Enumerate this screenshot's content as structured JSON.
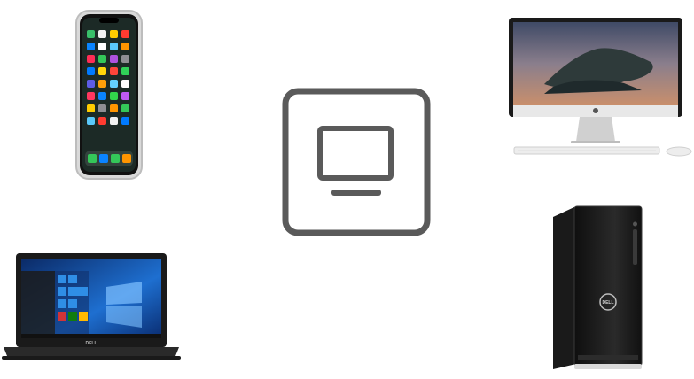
{
  "icons": {
    "phone": "smartphone-icon",
    "imac": "desktop-all-in-one-icon",
    "center": "monitor-icon",
    "laptop": "laptop-icon",
    "tower": "desktop-tower-icon"
  },
  "brand": {
    "laptop_logo": "DELL",
    "tower_logo": "DELL"
  },
  "colors": {
    "background": "#ffffff",
    "icon_stroke": "#5a5a5a",
    "device_black": "#1a1a1a",
    "windows_blue": "#1e6fd0",
    "mac_sky": "#6b7b9a"
  }
}
